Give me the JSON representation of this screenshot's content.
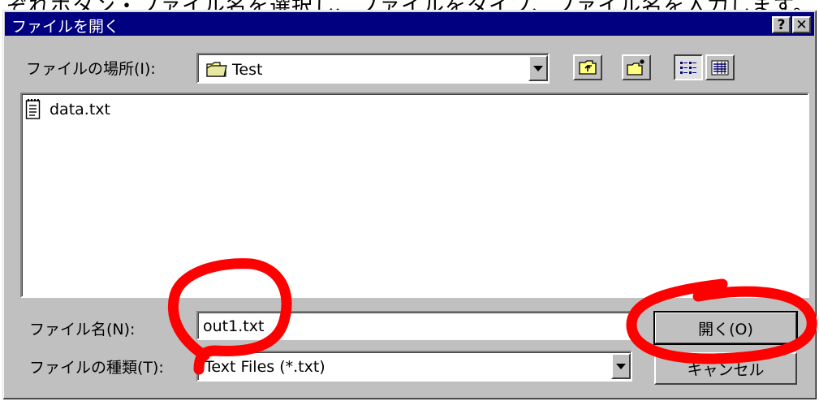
{
  "background_text": "ぞれボタン・ファイル名を選択し、ファイルをタイプ、ファイル名を入力します。",
  "dialog": {
    "title": "ファイルを開く",
    "help_button": "?",
    "close_button": "✕"
  },
  "location": {
    "label": "ファイルの場所(I):",
    "value": "Test"
  },
  "toolbar": {
    "up_folder": "up-one-level",
    "new_folder": "create-new-folder",
    "list_view": "list-view",
    "details_view": "details-view"
  },
  "files": [
    {
      "name": "data.txt",
      "icon": "text-file-icon"
    }
  ],
  "filename": {
    "label": "ファイル名(N):",
    "value": "out1.txt"
  },
  "filetype": {
    "label": "ファイルの種類(T):",
    "value": "Text Files (*.txt)"
  },
  "buttons": {
    "open": "開く(O)",
    "cancel": "キャンセル"
  },
  "annotation_color": "#ff0000",
  "colors": {
    "title_bar": "#000080",
    "dialog_face": "#c0c0c0"
  }
}
